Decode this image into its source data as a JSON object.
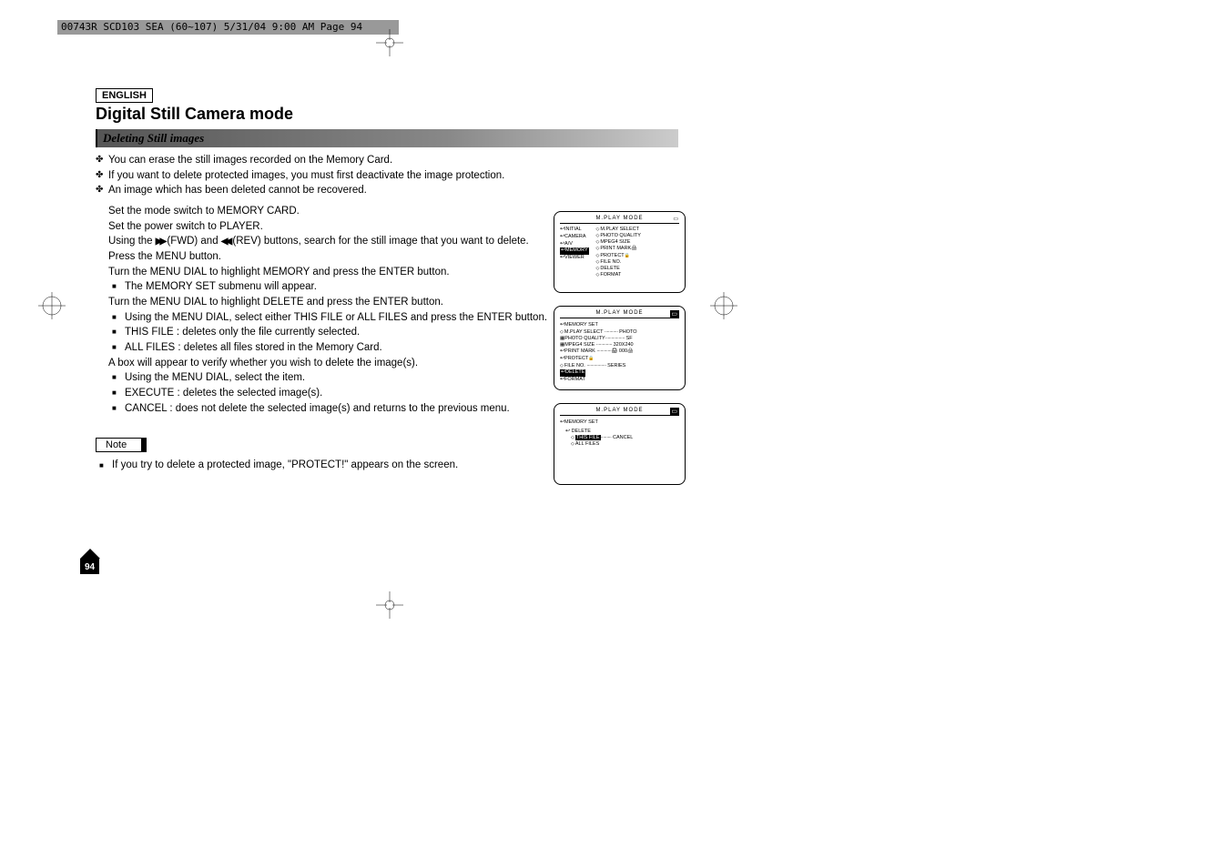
{
  "header_strip": "00743R SCD103 SEA (60~107)  5/31/04 9:00 AM  Page 94",
  "lang": "ENGLISH",
  "title": "Digital Still Camera mode",
  "subtitle": "Deleting Still images",
  "intro": [
    "You can erase the still images recorded on the Memory Card.",
    "If you want to delete protected images, you must first deactivate the image protection.",
    "An image which has been deleted cannot be recovered."
  ],
  "steps": {
    "1": "Set the mode switch to MEMORY CARD.",
    "2": "Set the power switch to PLAYER.",
    "3a": "Using the ",
    "3_fwd": "▶▶",
    "3_fwd_label": "(FWD) and ",
    "3_rev": "◀◀",
    "3_rev_label": "(REV) buttons, search for the still image that you want to delete.",
    "4": "Press the MENU button.",
    "5": "Turn the MENU DIAL to highlight MEMORY and press the ENTER button.",
    "5a": "The MEMORY SET submenu will appear.",
    "6": "Turn the MENU DIAL to highlight DELETE and press the ENTER button.",
    "6a": "Using the MENU DIAL, select either THIS FILE or ALL FILES and press the ENTER button.",
    "6b": "THIS FILE : deletes only the file currently selected.",
    "6c": "ALL FILES : deletes all files stored in the Memory Card.",
    "7": "A box will appear to verify whether you wish to delete the image(s).",
    "7a": "Using the MENU DIAL, select the item.",
    "7b": "EXECUTE : deletes the selected image(s).",
    "7c": "CANCEL : does not delete the selected image(s) and returns to the previous menu."
  },
  "note_label": "Note",
  "note_text": "If you try to delete a protected image, \"PROTECT!\" appears on the screen.",
  "page_num": "94",
  "lcd1": {
    "title": "M.PLAY  MODE",
    "left": [
      "INITIAL",
      "CAMERA",
      "A/V",
      "MEMORY",
      "VIEWER"
    ],
    "right": [
      "M.PLAY SELECT",
      "PHOTO QUALITY",
      "MPEG4 SIZE",
      "PRINT MARK",
      "PROTECT",
      "FILE NO.",
      "DELETE",
      "FORMAT"
    ]
  },
  "lcd2": {
    "title": "M.PLAY  MODE",
    "heading": "MEMORY SET",
    "rows": [
      {
        "l": "M.PLAY SELECT",
        "r": "PHOTO"
      },
      {
        "l": "PHOTO QUALITY",
        "r": "SF"
      },
      {
        "l": "MPEG4 SIZE",
        "r": "320X240"
      },
      {
        "l": "PRINT MARK",
        "r": "000"
      },
      {
        "l": "PROTECT",
        "r": ""
      },
      {
        "l": "FILE NO.",
        "r": "SERIES"
      },
      {
        "l": "DELETE",
        "r": ""
      },
      {
        "l": "FORMAT",
        "r": ""
      }
    ]
  },
  "lcd3": {
    "title": "M.PLAY  MODE",
    "heading": "MEMORY SET",
    "sub": "DELETE",
    "rows": [
      {
        "l": "THIS FILE",
        "r": "CANCEL"
      },
      {
        "l": "ALL FILES",
        "r": ""
      }
    ]
  }
}
